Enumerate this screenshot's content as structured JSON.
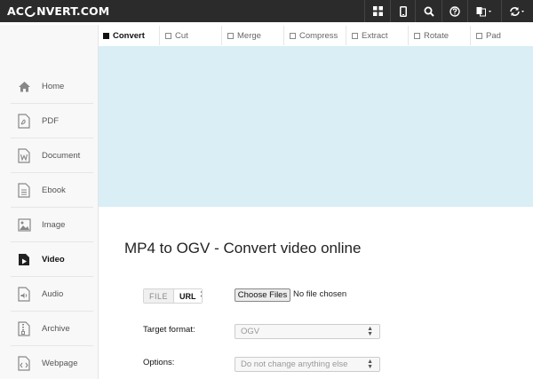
{
  "brand": {
    "prefix": "AC",
    "suffix": "NVERT.COM"
  },
  "topbar": {
    "icons": [
      "grid-icon",
      "mobile-icon",
      "search-icon",
      "help-icon",
      "language-icon",
      "sync-icon"
    ]
  },
  "tabs": [
    {
      "label": "Convert",
      "active": true
    },
    {
      "label": "Cut"
    },
    {
      "label": "Merge"
    },
    {
      "label": "Compress"
    },
    {
      "label": "Extract"
    },
    {
      "label": "Rotate"
    },
    {
      "label": "Pad"
    }
  ],
  "sidebar": {
    "items": [
      {
        "label": "Home",
        "icon": "home-icon"
      },
      {
        "label": "PDF",
        "icon": "pdf-icon"
      },
      {
        "label": "Document",
        "icon": "document-icon"
      },
      {
        "label": "Ebook",
        "icon": "ebook-icon"
      },
      {
        "label": "Image",
        "icon": "image-icon"
      },
      {
        "label": "Video",
        "icon": "video-icon",
        "active": true
      },
      {
        "label": "Audio",
        "icon": "audio-icon"
      },
      {
        "label": "Archive",
        "icon": "archive-icon"
      },
      {
        "label": "Webpage",
        "icon": "webpage-icon"
      }
    ]
  },
  "main": {
    "title": "MP4 to OGV - Convert video online",
    "source_toggle": {
      "file": "FILE",
      "url": "URL",
      "colon": ":"
    },
    "file_input": {
      "button": "Choose Files",
      "status": "No file chosen"
    },
    "target_format": {
      "label": "Target format:",
      "value": "OGV"
    },
    "options": {
      "label": "Options:",
      "value": "Do not change anything else"
    }
  },
  "colors": {
    "topbar": "#2b2b2b",
    "hero": "#d9eef5",
    "sidebar": "#f8f8f8"
  }
}
